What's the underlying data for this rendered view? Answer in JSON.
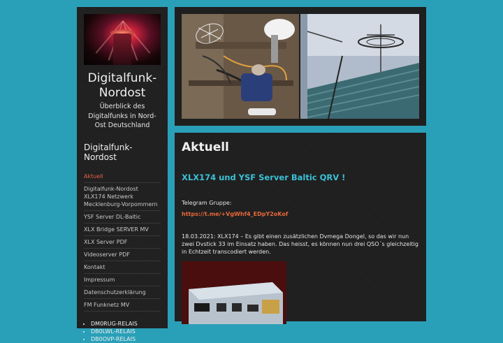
{
  "site": {
    "title": "Digitalfunk-Nordost",
    "description": "Überblick des Digitalfunks in Nord-Ost Deutschland"
  },
  "sidebar": {
    "nav_heading": "Digitalfunk-Nordost",
    "items": [
      {
        "label": "Aktuell",
        "active": true
      },
      {
        "label": "Digitalfunk-Nordost XLX174 Netzwerk Mecklenburg-Vorpommern"
      },
      {
        "label": "YSF Server DL-Baltic"
      },
      {
        "label": "XLX Bridge SERVER MV"
      },
      {
        "label": "XLX Server PDF"
      },
      {
        "label": "Videoserver PDF"
      },
      {
        "label": "Kontakt"
      },
      {
        "label": "Impressum"
      },
      {
        "label": "Datenschutzerklärung"
      },
      {
        "label": "FM Funknetz MV"
      }
    ],
    "relais": [
      "DM0RUG-RELAIS",
      "DB0LWL-RELAIS",
      "DB0OVP-RELAIS"
    ]
  },
  "main": {
    "page_title": "Aktuell",
    "post_heading": "XLX174 und YSF Server Baltic QRV !",
    "telegram_label": "Telegram Gruppe:",
    "telegram_link": "https://t.me/+VgWhf4_EDpY2oKof",
    "news_text": "18.03.2021:  XLX174 – Es gibt einen zusätzlichen Dvmega Dongel, so das wir nun zwei Dvstick 33 im Einsatz haben. Das heisst, es können nun drei QSO´s gleichzeitig in Echtzeit transcodiert werden."
  },
  "colors": {
    "background": "#2aa0b8",
    "panel": "#1f1f1f",
    "accent_active": "#e8604a",
    "heading_cyan": "#3bc0d6",
    "link_orange": "#e8683a"
  }
}
